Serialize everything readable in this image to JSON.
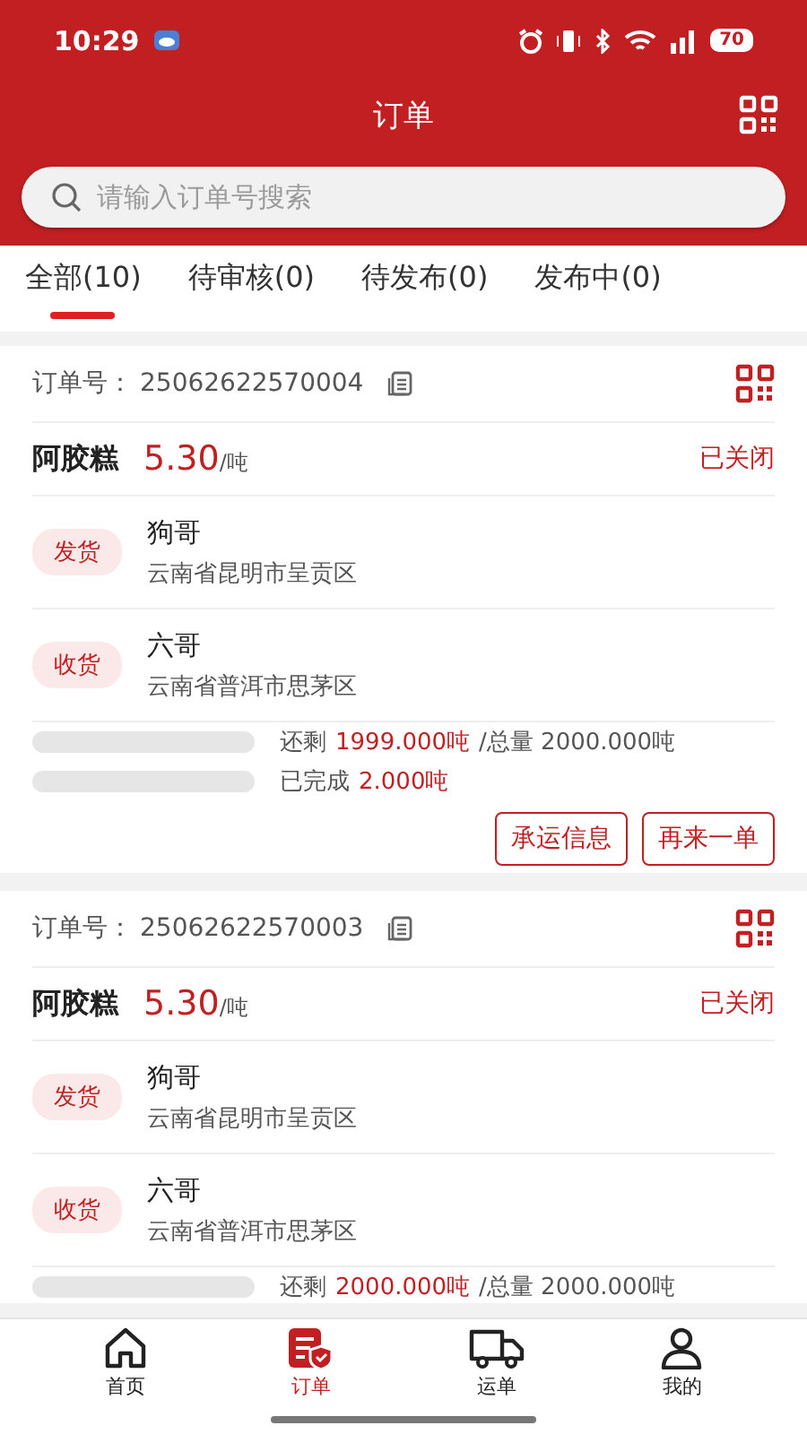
{
  "status_bar": {
    "time": "10:29",
    "battery": "70"
  },
  "header": {
    "title": "订单"
  },
  "search": {
    "placeholder": "请输入订单号搜索"
  },
  "tabs": [
    {
      "label": "全部(10)",
      "selected": true
    },
    {
      "label": "待审核(0)",
      "selected": false
    },
    {
      "label": "待发布(0)",
      "selected": false
    },
    {
      "label": "发布中(0)",
      "selected": false
    }
  ],
  "orders": [
    {
      "order_no_label": "订单号：",
      "order_no": "25062622570004",
      "product": "阿胶糕",
      "price": "5.30",
      "unit": "/吨",
      "status": "已关闭",
      "parties": [
        {
          "tag": "发货",
          "name": "狗哥",
          "address": "云南省昆明市呈贡区"
        },
        {
          "tag": "收货",
          "name": "六哥",
          "address": "云南省普洱市思茅区"
        }
      ],
      "progress": [
        {
          "label": "还剩",
          "value": "1999.000吨",
          "total": "/总量 2000.000吨",
          "level": 0
        },
        {
          "label": "已完成",
          "value": "2.000吨",
          "level": 0
        }
      ],
      "buttons": [
        "承运信息",
        "再来一单"
      ]
    },
    {
      "order_no_label": "订单号：",
      "order_no": "25062622570003",
      "product": "阿胶糕",
      "price": "5.30",
      "unit": "/吨",
      "status": "已关闭",
      "parties": [
        {
          "tag": "发货",
          "name": "狗哥",
          "address": "云南省昆明市呈贡区"
        },
        {
          "tag": "收货",
          "name": "六哥",
          "address": "云南省普洱市思茅区"
        }
      ],
      "progress": [
        {
          "label": "还剩",
          "value": "2000.000吨",
          "total": "/总量 2000.000吨",
          "level": 0
        }
      ]
    }
  ],
  "nav": [
    {
      "kind": "home",
      "label": "首页",
      "selected": false
    },
    {
      "kind": "order",
      "label": "订单",
      "selected": true
    },
    {
      "kind": "truck",
      "label": "运单",
      "selected": false
    },
    {
      "kind": "person",
      "label": "我的",
      "selected": false
    }
  ]
}
